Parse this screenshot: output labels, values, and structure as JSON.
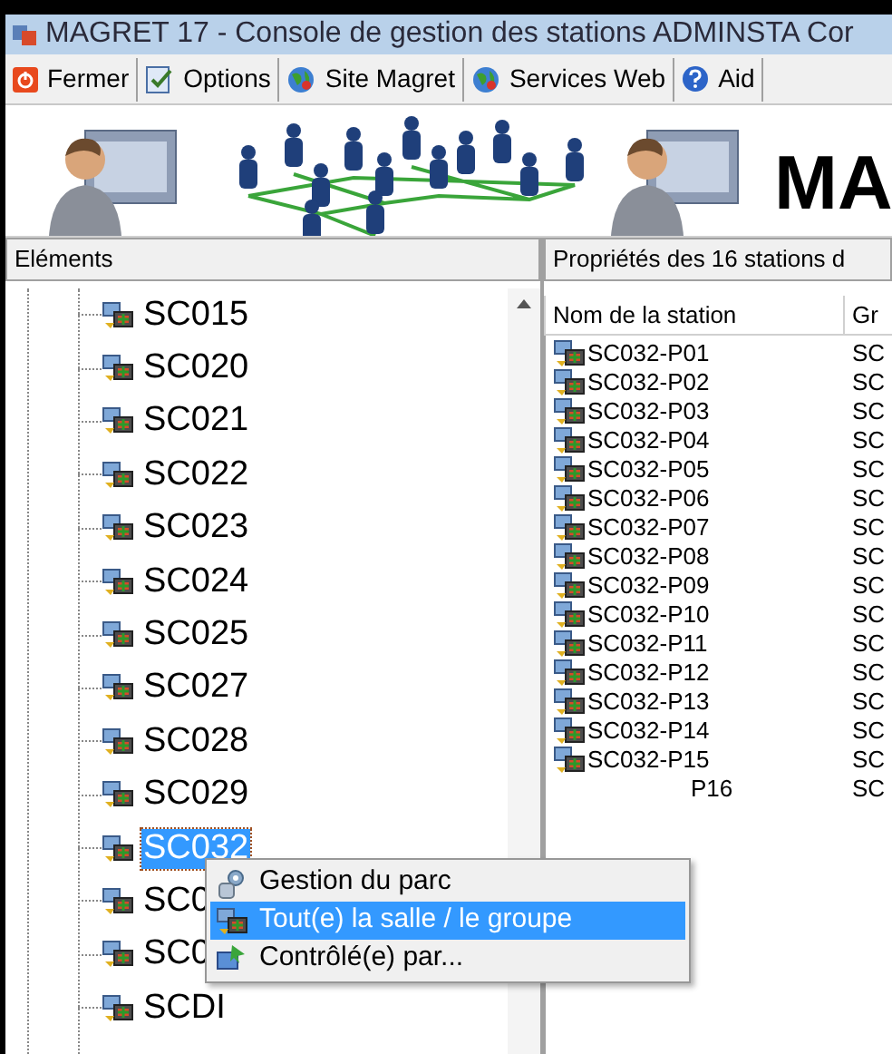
{
  "window": {
    "title": "MAGRET 17 - Console de gestion des stations ADMINSTA  Cor"
  },
  "toolbar": [
    {
      "label": "Fermer",
      "kind": "power"
    },
    {
      "label": "Options",
      "kind": "options"
    },
    {
      "label": "Site Magret",
      "kind": "globe"
    },
    {
      "label": "Services Web",
      "kind": "globe"
    },
    {
      "label": "Aid",
      "kind": "help"
    }
  ],
  "banner": {
    "logo_text": "MA"
  },
  "tree": {
    "header": "Eléments",
    "items": [
      {
        "label": "SC015",
        "selected": false
      },
      {
        "label": "SC020",
        "selected": false
      },
      {
        "label": "SC021",
        "selected": false
      },
      {
        "label": "SC022",
        "selected": false
      },
      {
        "label": "SC023",
        "selected": false
      },
      {
        "label": "SC024",
        "selected": false
      },
      {
        "label": "SC025",
        "selected": false
      },
      {
        "label": "SC027",
        "selected": false
      },
      {
        "label": "SC028",
        "selected": false
      },
      {
        "label": "SC029",
        "selected": false
      },
      {
        "label": "SC032",
        "selected": true
      },
      {
        "label": "SC0",
        "selected": false
      },
      {
        "label": "SC0",
        "selected": false
      },
      {
        "label": "SCDI",
        "selected": false
      }
    ]
  },
  "panel": {
    "header": "Propriétés des 16 stations d",
    "columns": [
      "Nom de la station",
      "Gr"
    ],
    "rows": [
      [
        "SC032-P01",
        "SC"
      ],
      [
        "SC032-P02",
        "SC"
      ],
      [
        "SC032-P03",
        "SC"
      ],
      [
        "SC032-P04",
        "SC"
      ],
      [
        "SC032-P05",
        "SC"
      ],
      [
        "SC032-P06",
        "SC"
      ],
      [
        "SC032-P07",
        "SC"
      ],
      [
        "SC032-P08",
        "SC"
      ],
      [
        "SC032-P09",
        "SC"
      ],
      [
        "SC032-P10",
        "SC"
      ],
      [
        "SC032-P11",
        "SC"
      ],
      [
        "SC032-P12",
        "SC"
      ],
      [
        "SC032-P13",
        "SC"
      ],
      [
        "SC032-P14",
        "SC"
      ],
      [
        "SC032-P15",
        "SC"
      ],
      [
        "P16",
        "SC"
      ]
    ]
  },
  "context_menu": [
    {
      "label": "Gestion du parc",
      "kind": "gear",
      "selected": false
    },
    {
      "label": "Tout(e) la salle / le groupe",
      "kind": "room",
      "selected": true
    },
    {
      "label": "Contrôlé(e) par...",
      "kind": "control",
      "selected": false
    }
  ]
}
